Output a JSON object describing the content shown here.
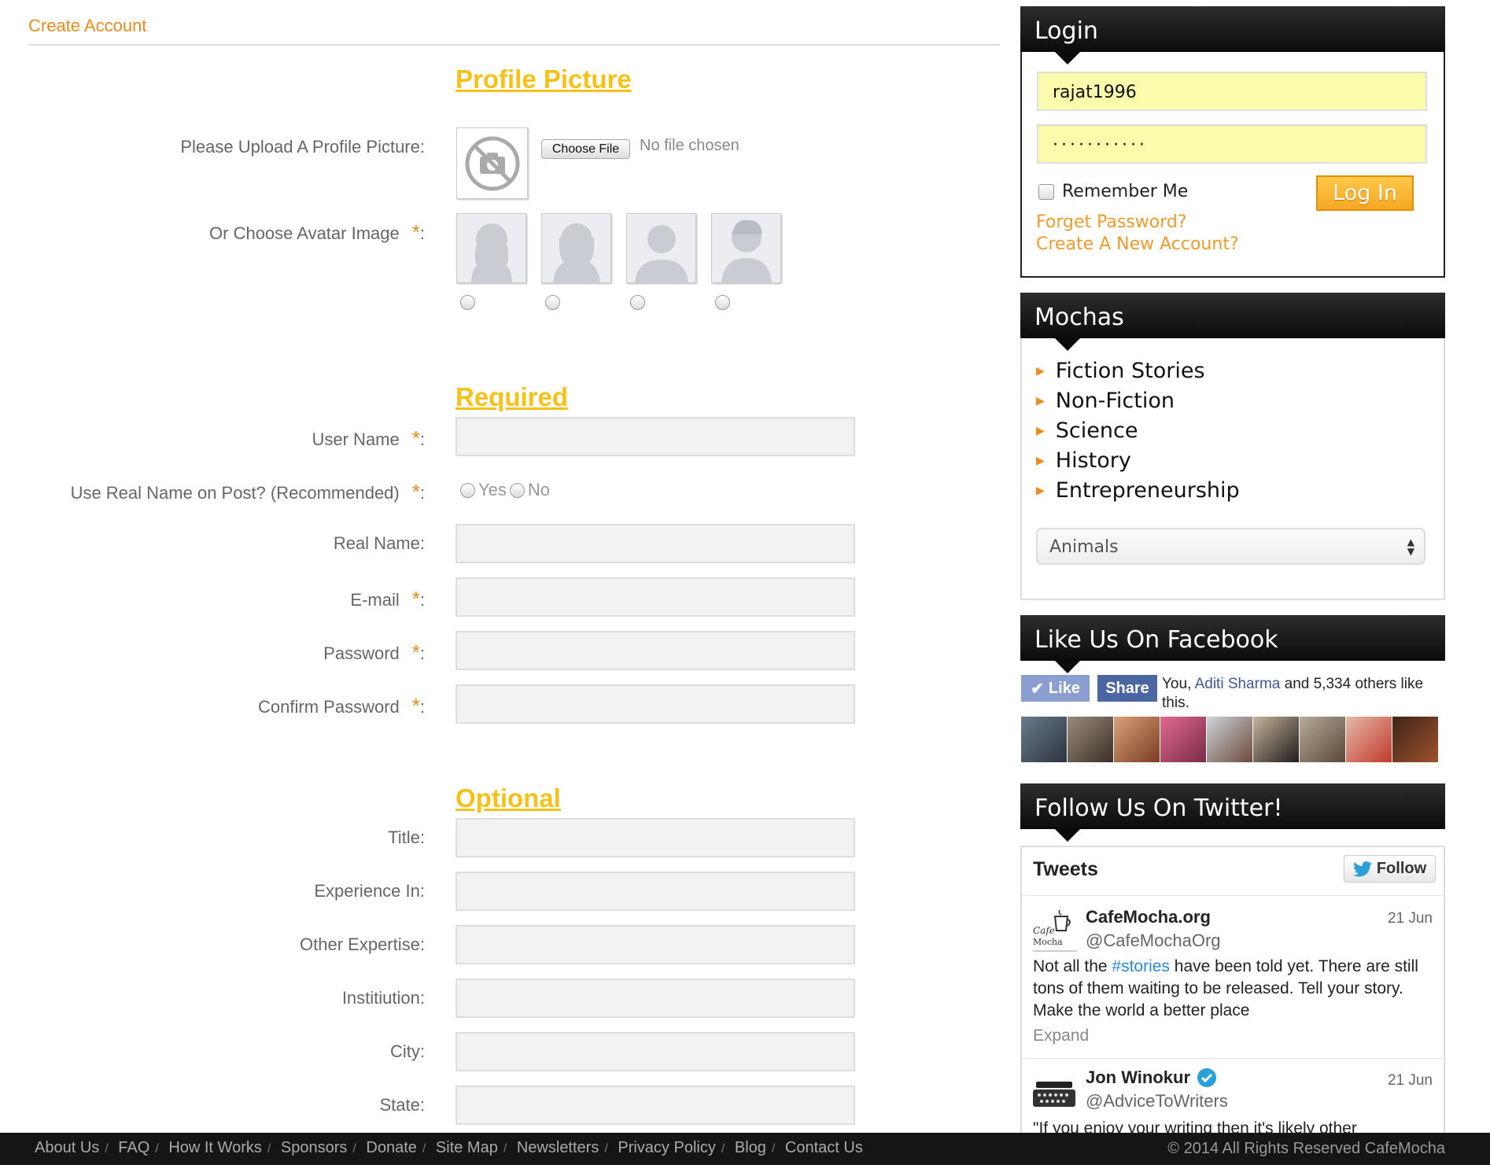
{
  "breadcrumb": "Create Account",
  "sections": {
    "profile_picture": "Profile Picture",
    "required": "Required",
    "optional": "Optional"
  },
  "profile": {
    "upload_label": "Please Upload A Profile Picture",
    "choose_file": "Choose File",
    "no_file": "No file chosen",
    "avatar_label": "Or Choose Avatar Image"
  },
  "required_fields": {
    "username": "User Name",
    "use_real_name": "Use Real Name on Post? (Recommended)",
    "yes": "Yes",
    "no": "No",
    "real_name": "Real Name",
    "email": "E-mail",
    "password": "Password",
    "confirm_password": "Confirm Password"
  },
  "optional_fields": {
    "title": "Title",
    "experience": "Experience In",
    "other_expertise": "Other Expertise",
    "institution": "Institiution",
    "city": "City",
    "state": "State"
  },
  "login": {
    "title": "Login",
    "username_value": "rajat1996",
    "password_value": "···········",
    "remember_me": "Remember Me",
    "login_button": "Log In",
    "forgot_password": "Forget Password?",
    "create_account": "Create A New Account?"
  },
  "mochas": {
    "title": "Mochas",
    "items": [
      "Fiction Stories",
      "Non-Fiction",
      "Science",
      "History",
      "Entrepreneurship"
    ],
    "select_value": "Animals"
  },
  "facebook": {
    "title": "Like Us On Facebook",
    "like": "Like",
    "share": "Share",
    "text_before": "You,",
    "friend_name": "Aditi Sharma",
    "text_after": "and 5,334 others like this."
  },
  "twitter": {
    "title": "Follow Us On Twitter!",
    "tweets_heading": "Tweets",
    "follow": "Follow",
    "tweets": [
      {
        "name": "CafeMocha.org",
        "handle": "@CafeMochaOrg",
        "date": "21 Jun",
        "text_before": "Not all the",
        "hashtag": "#stories",
        "text_after": "have been told yet. There are still tons of them waiting to be released. Tell your story. Make the world a better place",
        "expand": "Expand"
      },
      {
        "name": "Jon Winokur",
        "handle": "@AdviceToWriters",
        "date": "21 Jun",
        "text": "\"If you enjoy your writing then it's likely other"
      }
    ]
  },
  "footer": {
    "links": [
      "About Us",
      "FAQ",
      "How It Works",
      "Sponsors",
      "Donate",
      "Site Map",
      "Newsletters",
      "Privacy Policy",
      "Blog",
      "Contact Us"
    ],
    "copyright": "© 2014 All Rights Reserved CafeMocha"
  },
  "colors": {
    "accent_orange": "#ef8a1c",
    "section_yellow": "#f6c21a",
    "login_input_bg": "#fbfcab",
    "facebook_blue": "#4c66a4",
    "twitter_link": "#2a8ad3"
  }
}
